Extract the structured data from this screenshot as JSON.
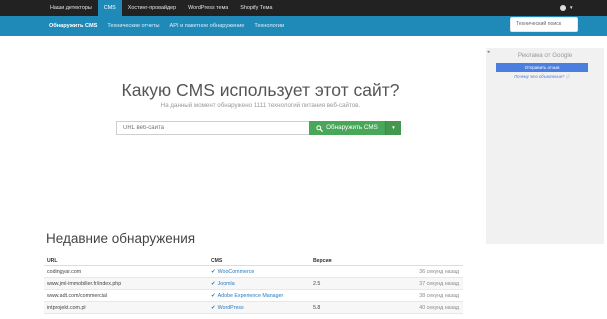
{
  "topnav": {
    "items": [
      {
        "label": "Наши детекторы"
      },
      {
        "label": "CMS"
      },
      {
        "label": "Хостинг-провайдер"
      },
      {
        "label": "WordPress тема"
      },
      {
        "label": "Shopify Тема"
      }
    ]
  },
  "subnav": {
    "items": [
      {
        "label": "Обнаружить CMS"
      },
      {
        "label": "Технические отчеты"
      },
      {
        "label": "API и пакетное обнаружение"
      },
      {
        "label": "Технологии"
      }
    ],
    "search_placeholder": "Технический поиск"
  },
  "hero": {
    "title": "Какую CMS использует этот сайт?",
    "subtitle": "На данный момент обнаружено 1111 технологий питания веб-сайтов."
  },
  "search": {
    "placeholder": "URL веб-сайта",
    "button_label": "Обнаружить CMS"
  },
  "ad": {
    "label": "Реклама от Google",
    "send_label": "Отправить отзыв",
    "why_label": "Почему это объявление? ⓘ"
  },
  "recent": {
    "title": "Недавние обнаружения",
    "columns": [
      "URL",
      "CMS",
      "Версия"
    ],
    "rows": [
      {
        "url": "codingyar.com",
        "cms": "WooCommerce",
        "version": "",
        "time": "36 секунд назад"
      },
      {
        "url": "www.jml-immobilier.fr/index.php",
        "cms": "Joomla",
        "version": "2.5",
        "time": "37 секунд назад"
      },
      {
        "url": "www.adt.com/commercial",
        "cms": "Adobe Experience Manager",
        "version": "",
        "time": "38 секунд назад"
      },
      {
        "url": "intprojekt.com.pl",
        "cms": "WordPress",
        "version": "5.8",
        "time": "40 секунд назад"
      }
    ]
  },
  "colors": {
    "topbar": "#222222",
    "accent": "#1f8ab8",
    "detect_button": "#49a75a",
    "link": "#2a7bc0"
  }
}
